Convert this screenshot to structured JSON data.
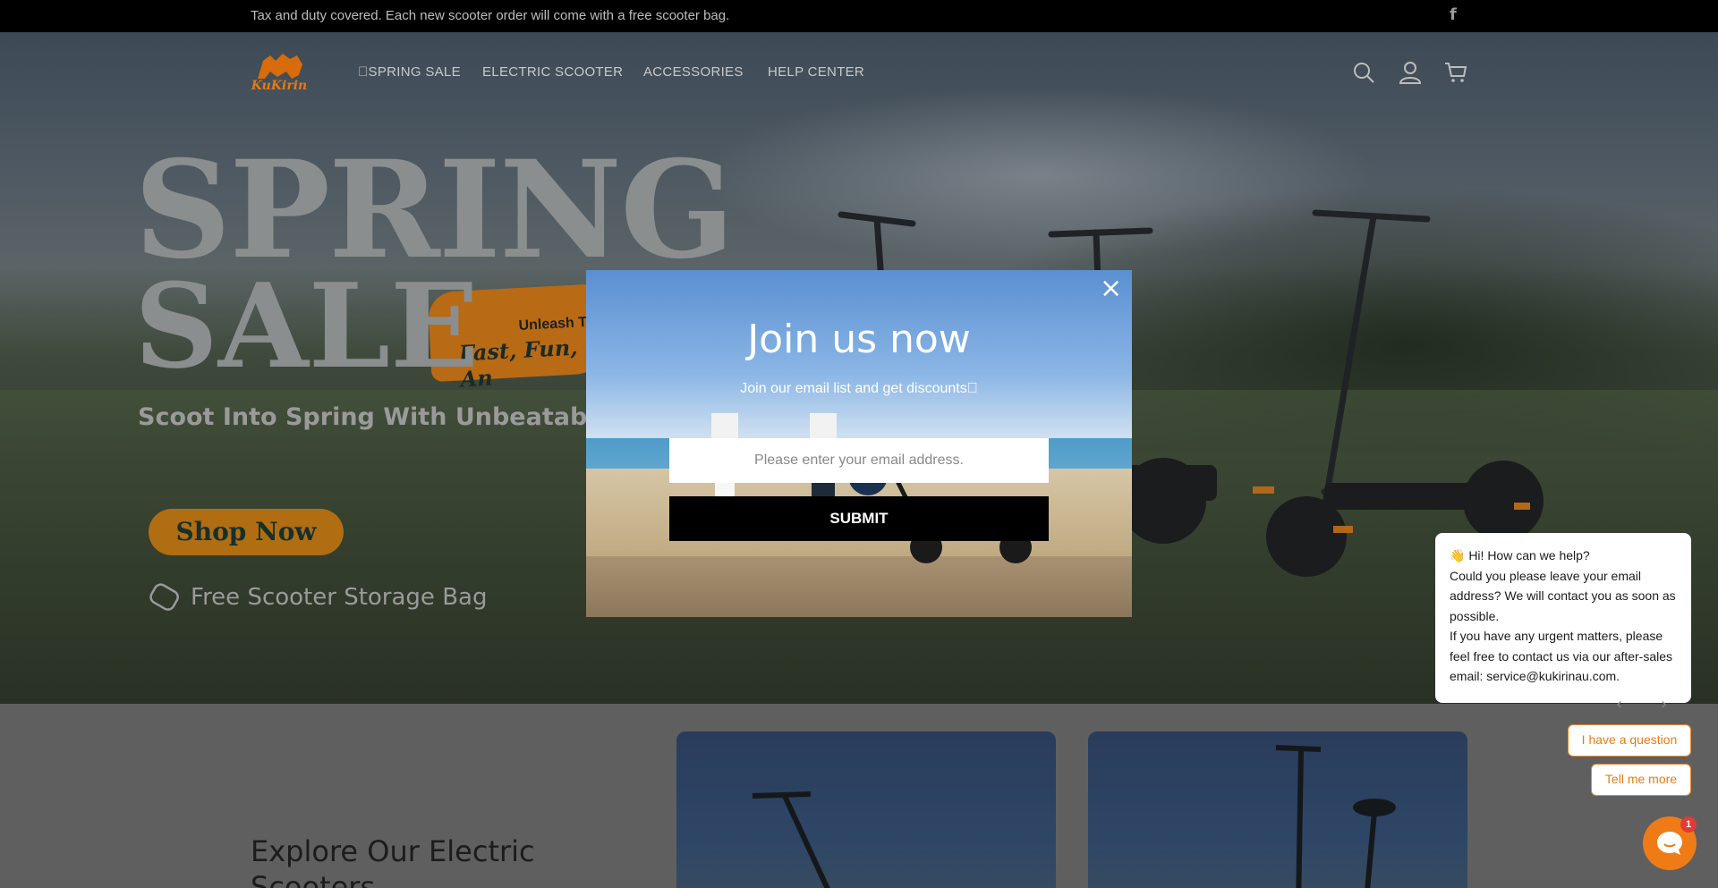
{
  "announcement": {
    "text": "Tax and duty covered. Each new scooter order will come with a free scooter bag.",
    "social": "f"
  },
  "logo": {
    "text": "KuKirin"
  },
  "nav": [
    {
      "label": "\u0000SPRING SALE"
    },
    {
      "label": "ELECTRIC SCOOTER"
    },
    {
      "label": "ACCESSORIES"
    },
    {
      "label": "HELP CENTER"
    }
  ],
  "header_icons": [
    "search-icon",
    "account-icon",
    "cart-icon"
  ],
  "hero": {
    "headline_1": "SPRING",
    "headline_2": "SALE",
    "brush_line_1": "Unleash T",
    "brush_line_2": "Fast, Fun, An",
    "tagline": "Scoot Into Spring With Unbeatable Dea",
    "cta": "Shop Now",
    "perk": "Free Scooter Storage Bag"
  },
  "section": {
    "title": "Explore Our Electric Scooters"
  },
  "popup": {
    "title": "Join us now",
    "subtitle": "Join our email list and get discounts\u0000",
    "email_placeholder": "Please enter your email address.",
    "submit_label": "SUBMIT",
    "close_label": "×"
  },
  "chat": {
    "greeting": "👋 Hi! How can we help?",
    "body_1": "Could you please leave your email address? We will contact you as soon as possible.",
    "body_2": "If you have any urgent matters, please feel free to contact us via our after-sales email: service@kukirinau.com.",
    "option_1": "I have a question",
    "option_2": "Tell me more",
    "unread": "1"
  },
  "colors": {
    "accent": "#ef7b16",
    "brand_orange": "#e37b12",
    "topbar": "#000000"
  }
}
